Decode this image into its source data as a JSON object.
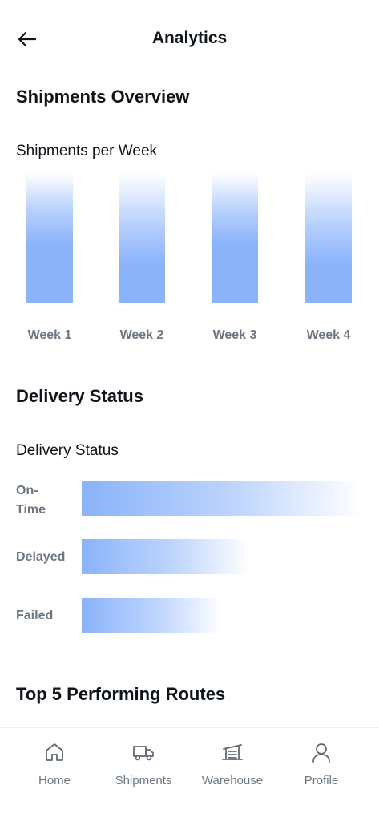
{
  "header": {
    "title": "Analytics",
    "back_icon": "arrow-left-icon"
  },
  "shipments_overview": {
    "heading": "Shipments Overview",
    "chart_title": "Shipments per Week",
    "chart_data": {
      "type": "bar",
      "categories": [
        "Week 1",
        "Week 2",
        "Week 3",
        "Week 4"
      ],
      "title": "Shipments per Week",
      "color": "#8ab3fa"
    }
  },
  "delivery_status": {
    "heading": "Delivery Status",
    "chart_title": "Delivery Status",
    "chart_data": {
      "type": "bar",
      "orientation": "horizontal",
      "categories": [
        "On-Time",
        "Delayed",
        "Failed"
      ],
      "values": [
        1.0,
        0.6,
        0.5
      ],
      "title": "Delivery Status",
      "color": "#8ab3fa"
    }
  },
  "routes": {
    "heading": "Top 5 Performing Routes"
  },
  "nav": {
    "items": [
      {
        "label": "Home",
        "icon": "home-icon"
      },
      {
        "label": "Shipments",
        "icon": "truck-icon"
      },
      {
        "label": "Warehouse",
        "icon": "warehouse-icon"
      },
      {
        "label": "Profile",
        "icon": "user-icon"
      }
    ]
  }
}
